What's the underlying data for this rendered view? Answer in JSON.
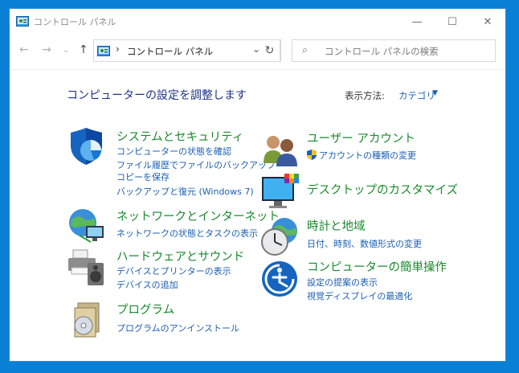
{
  "window": {
    "title": "コントロール パネル",
    "accent": "#0a7fd6",
    "controls": {
      "minimize": "—",
      "maximize": "☐",
      "close": "✕"
    }
  },
  "nav": {
    "back": "←",
    "forward": "→",
    "recent": "⌄",
    "up": "↑",
    "address_sep": "›",
    "address": "コントロール パネル",
    "address_dropdown": "⌄",
    "refresh": "↻",
    "search_icon": "⌕",
    "search_placeholder": "コントロール パネルの検索"
  },
  "header": {
    "title": "コンピューターの設定を調整します",
    "view_by_label": "表示方法:",
    "view_by_value": "カテゴリ",
    "view_by_arrow": "▼"
  },
  "categories": [
    {
      "title": "システムとセキュリティ",
      "icon": "shield-icon",
      "links": [
        "コンピューターの状態を確認",
        "ファイル履歴でファイルのバックアップ",
        "コピーを保存",
        "バックアップと復元 (Windows 7)"
      ]
    },
    {
      "title": "ネットワークとインターネット",
      "icon": "network-globe-icon",
      "links": [
        "ネットワークの状態とタスクの表示"
      ]
    },
    {
      "title": "ハードウェアとサウンド",
      "icon": "printer-speaker-icon",
      "links": [
        "デバイスとプリンターの表示",
        "デバイスの追加"
      ]
    },
    {
      "title": "プログラム",
      "icon": "programs-disc-icon",
      "links": [
        "プログラムのアンインストール"
      ]
    },
    {
      "title": "ユーザー アカウント",
      "icon": "users-icon",
      "links": [
        "アカウントの種類の変更"
      ]
    },
    {
      "title": "デスクトップのカスタマイズ",
      "icon": "monitor-palette-icon",
      "links": []
    },
    {
      "title": "時計と地域",
      "icon": "clock-globe-icon",
      "links": [
        "日付、時刻、数値形式の変更"
      ]
    },
    {
      "title": "コンピューターの簡単操作",
      "icon": "ease-of-access-icon",
      "links": [
        "設定の提案の表示",
        "視覚ディスプレイの最適化"
      ]
    }
  ]
}
